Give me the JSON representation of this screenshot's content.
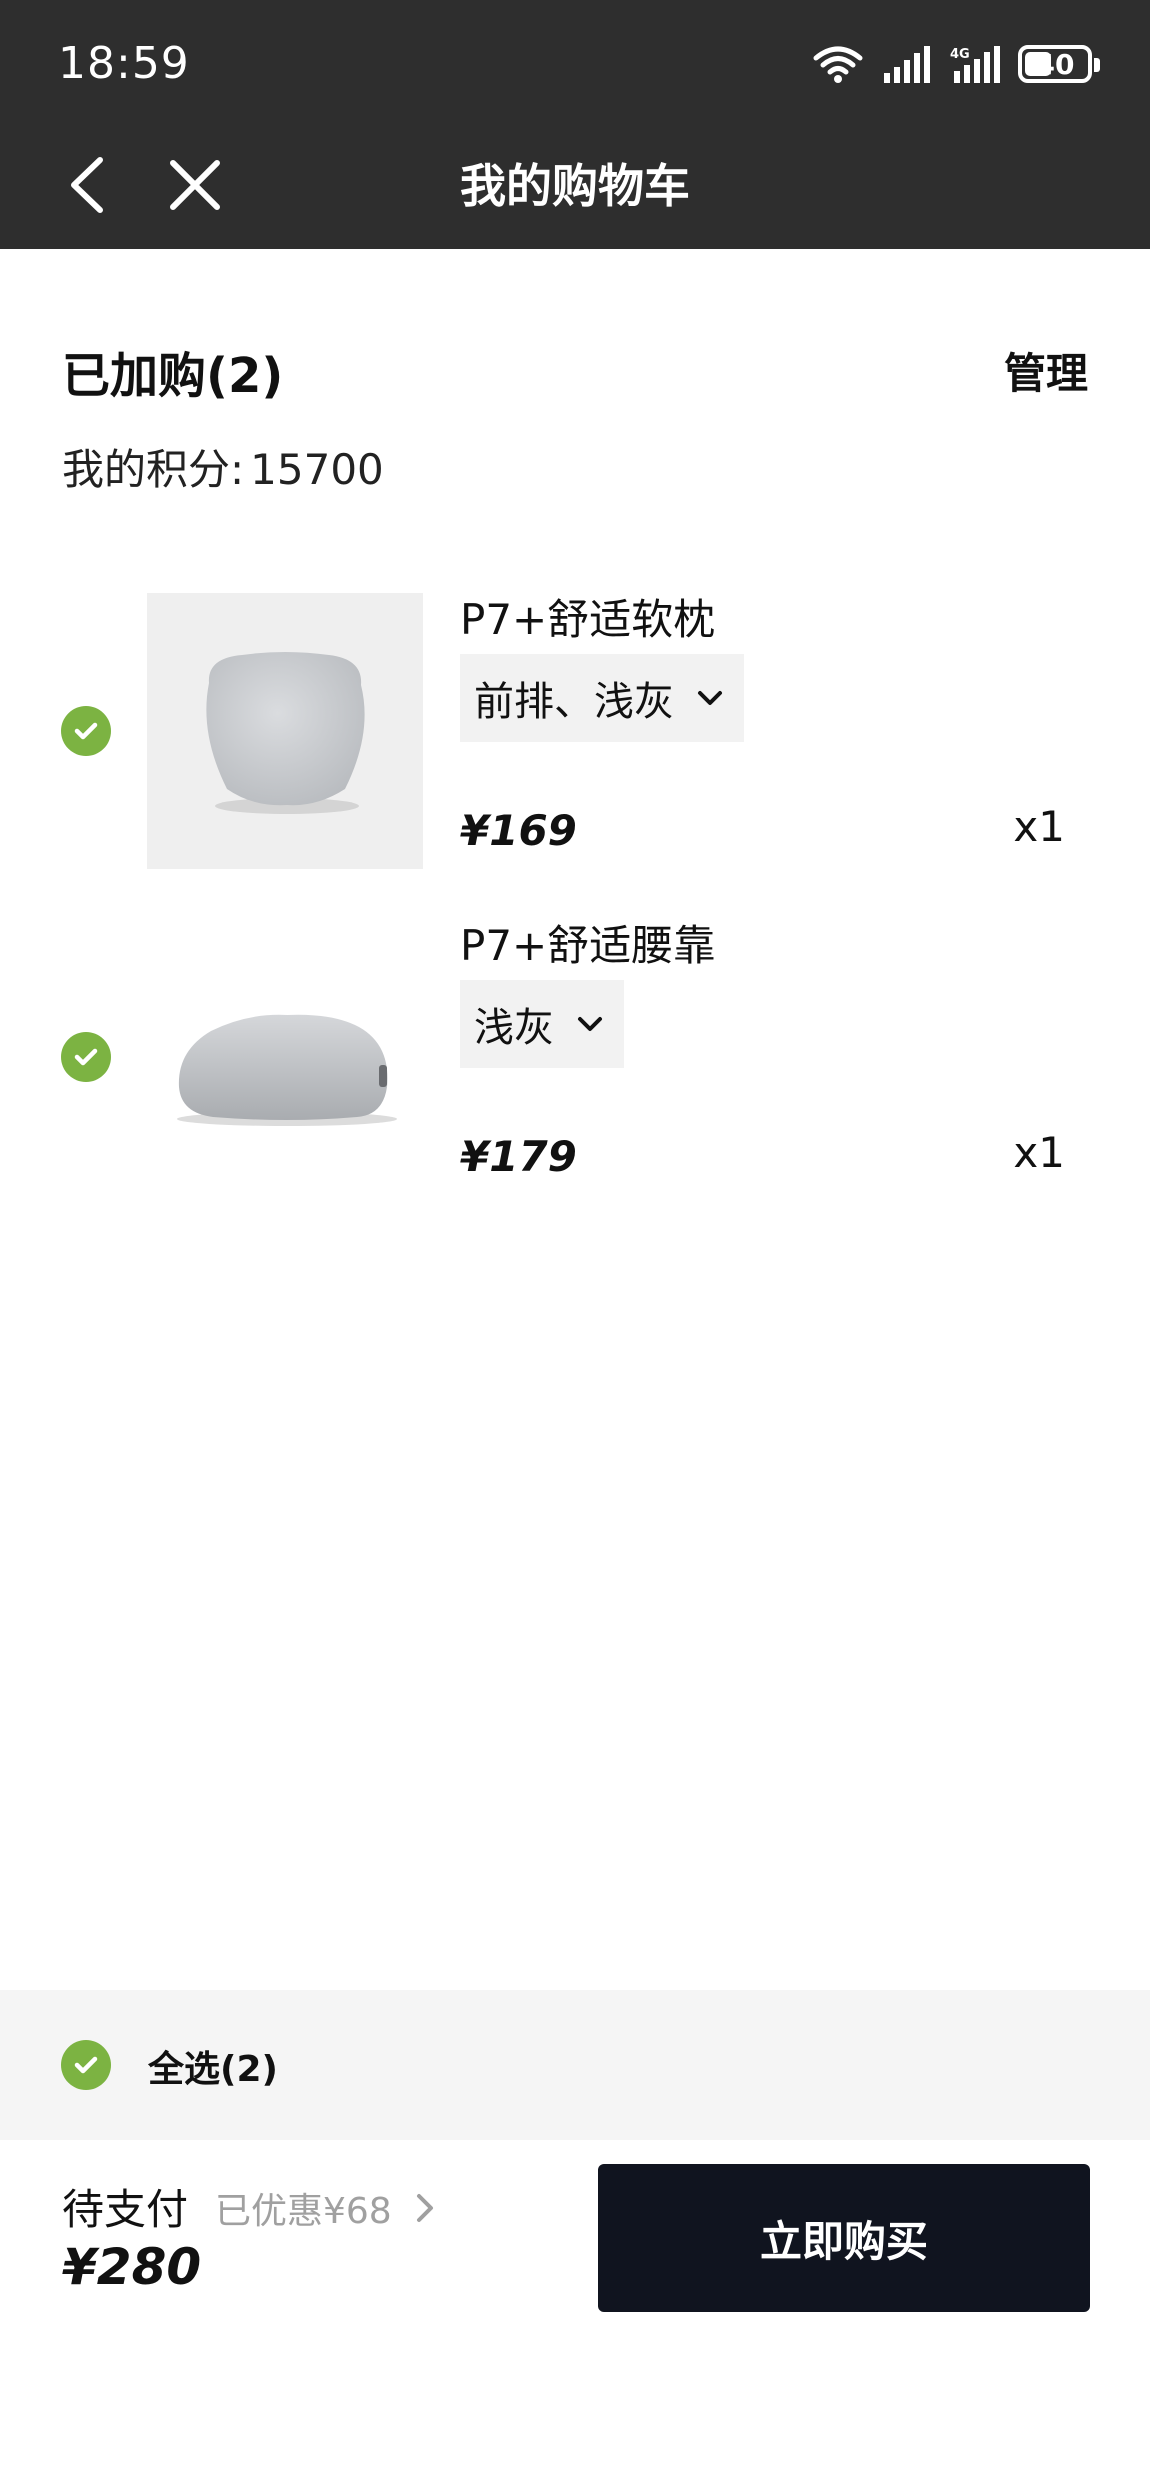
{
  "status_bar": {
    "time": "18:59",
    "network": "4G",
    "battery": "40"
  },
  "header": {
    "title": "我的购物车",
    "back_icon": "chevron-left-icon",
    "close_icon": "close-icon"
  },
  "cart": {
    "count_label": "已加购(2)",
    "manage_label": "管理",
    "points_label": "我的积分:",
    "points_value": "15700"
  },
  "items": [
    {
      "name": "P7+舒适软枕",
      "option": "前排、浅灰",
      "price": "¥169",
      "qty": "x1",
      "selected": true
    },
    {
      "name": "P7+舒适腰靠",
      "option": "浅灰",
      "price": "¥179",
      "qty": "x1",
      "selected": true
    }
  ],
  "select_all": {
    "label": "全选(2)",
    "selected": true
  },
  "footer": {
    "pay_label": "待支付",
    "discount_label": "已优惠¥68",
    "total": "¥280",
    "buy_label": "立即购买"
  },
  "colors": {
    "check_green": "#7cb342",
    "topbar": "#2e2e2e",
    "buy_button": "#10141f"
  }
}
